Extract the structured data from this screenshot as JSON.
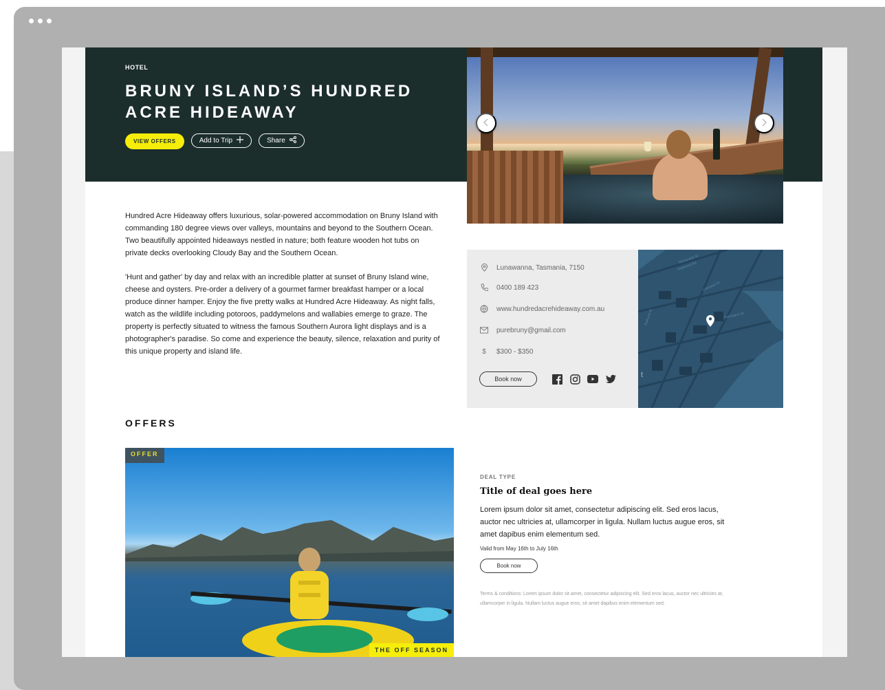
{
  "window": {
    "dots": [
      "dot",
      "dot",
      "dot"
    ]
  },
  "hero": {
    "category": "HOTEL",
    "title": "BRUNY ISLAND’S HUNDRED ACRE HIDEAWAY",
    "view_offers_label": "VIEW OFFERS",
    "add_to_trip_label": "Add to Trip",
    "share_label": "Share",
    "prev_icon": "chevron-left-icon",
    "next_icon": "chevron-right-icon"
  },
  "description": {
    "paragraphs": [
      "Hundred Acre Hideaway offers luxurious, solar-powered accommodation on Bruny Island with commanding 180 degree views over valleys, mountains and beyond to the Southern Ocean. Two beautifully appointed hideaways nestled in nature; both feature wooden hot tubs on private decks overlooking Cloudy Bay and the Southern Ocean.",
      "'Hunt and gather' by day and relax with an incredible platter at sunset of Bruny Island wine, cheese and oysters. Pre-order a delivery of a gourmet farmer breakfast hamper or a local produce dinner hamper. Enjoy the five pretty walks at Hundred Acre Hideaway. As night falls, watch as the wildlife including potoroos, paddymelons and wallabies emerge to graze. The property is perfectly situated to witness the famous Southern Aurora light displays and is a photographer's paradise. So come and experience the beauty, silence, relaxation and purity of this unique property and island life."
    ]
  },
  "contact": {
    "address": "Lunawanna, Tasmania, 7150",
    "phone": "0400 189 423",
    "website": "www.hundredacrehideaway.com.au",
    "email": "purebruny@gmail.com",
    "price": "$300 - $350",
    "price_symbol": "$",
    "book_label": "Book now",
    "social_icons": [
      "facebook-icon",
      "instagram-icon",
      "youtube-icon",
      "twitter-icon"
    ]
  },
  "map": {
    "streets": [
      "Hopwood Rd",
      "Liverpool St",
      "Bathurst St",
      "Harrington St",
      "Macquarie St"
    ],
    "edge_letter": "t"
  },
  "offers": {
    "heading": "OFFERS",
    "badge": "OFFER",
    "season_tag": "THE OFF SEASON",
    "deal_type": "DEAL TYPE",
    "deal_title": "Title of deal goes here",
    "deal_body": "Lorem ipsum dolor sit amet, consectetur adipiscing elit. Sed eros lacus, auctor nec ultricies at, ullamcorper in ligula. Nullam luctus augue eros, sit amet dapibus enim elementum sed.",
    "valid": "Valid from May 16th to July 16th",
    "book_label": "Book now",
    "terms": "Terms & conditions: Lorem ipsum dolor sit amet, consectetur adipiscing elit. Sed eros lacus, auctor nec ultricies at, ullamcorper in ligula. Nullam luctus augue eros, sit amet dapibus enim elementum sed."
  },
  "colors": {
    "hero_bg": "#1c2e2c",
    "accent_yellow": "#f6ee0a",
    "map_bg": "#2f5470",
    "info_bg": "#ececec"
  }
}
